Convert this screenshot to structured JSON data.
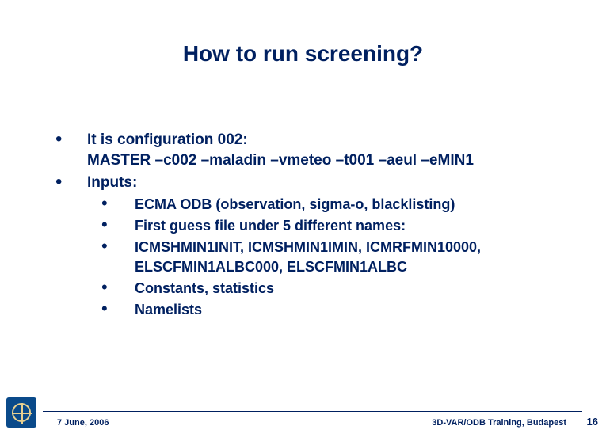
{
  "title": "How to run screening?",
  "bullets": [
    {
      "text": "It is configuration 002:",
      "cont": "MASTER –c002 –maladin –vmeteo –t001 –aeul –eMIN1"
    },
    {
      "text": "Inputs:",
      "sub": [
        "ECMA ODB (observation, sigma-o, blacklisting)",
        "First guess file under 5 different names:",
        "ICMSHMIN1INIT, ICMSHMIN1IMIN, ICMRFMIN10000, ELSCFMIN1ALBC000, ELSCFMIN1ALBC",
        "Constants, statistics",
        "Namelists"
      ]
    }
  ],
  "footer": {
    "date": "7 June, 2006",
    "course": "3D-VAR/ODB Training, Budapest",
    "page": "16"
  }
}
